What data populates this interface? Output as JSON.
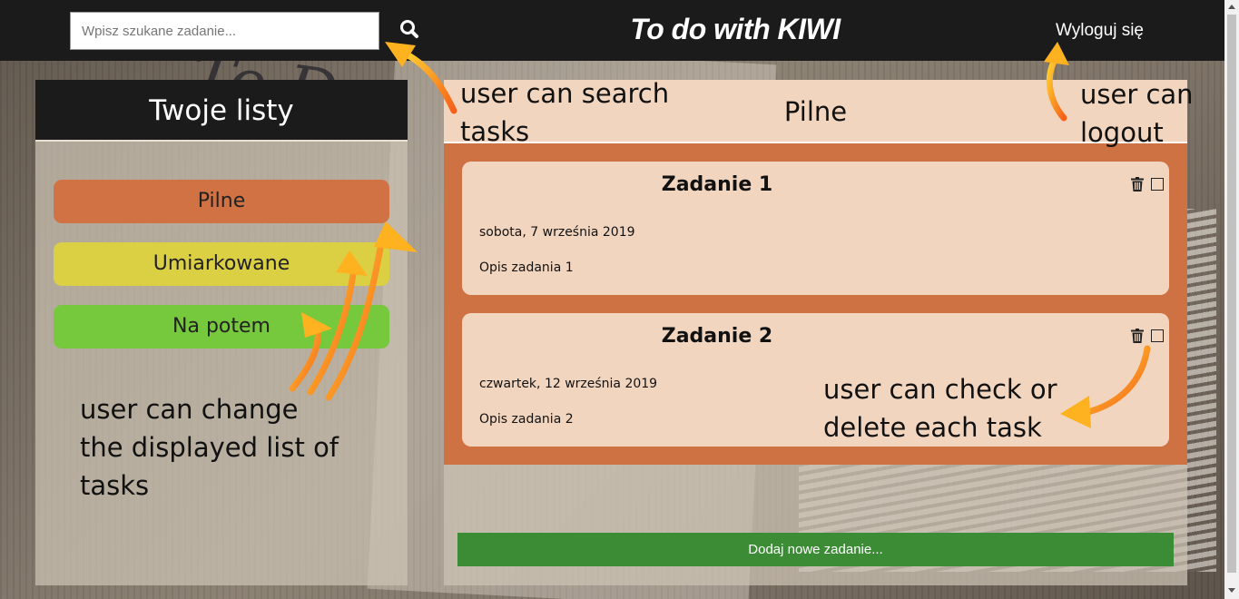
{
  "header": {
    "search_placeholder": "Wpisz szukane zadanie...",
    "search_icon": "search-icon",
    "title": "To do with KIWI",
    "logout_label": "Wyloguj się"
  },
  "sidebar": {
    "title": "Twoje listy",
    "lists": [
      {
        "label": "Pilne",
        "color": "#d17244"
      },
      {
        "label": "Umiarkowane",
        "color": "#dbcf44"
      },
      {
        "label": "Na potem",
        "color": "#76c93c"
      }
    ]
  },
  "main": {
    "list_title": "Pilne",
    "tasks": [
      {
        "title": "Zadanie 1",
        "date": "sobota, 7 września 2019",
        "description": "Opis zadania 1"
      },
      {
        "title": "Zadanie 2",
        "date": "czwartek, 12 września 2019",
        "description": "Opis zadania 2"
      }
    ],
    "add_button_label": "Dodaj nowe zadanie..."
  },
  "annotations": {
    "search_line1": "user can search",
    "search_line2": "tasks",
    "logout_line1": "user can",
    "logout_line2": "logout",
    "lists_line1": "user can change",
    "lists_line2": "the displayed list of",
    "lists_line3": "tasks",
    "task_line1": "user can check or",
    "task_line2": "delete each task"
  },
  "colors": {
    "header_bg": "#1b1b1b",
    "task_area": "#cf7243",
    "task_card": "#f2d5bf",
    "add_button": "#3b8c35",
    "arrow": "#f59a1e"
  }
}
